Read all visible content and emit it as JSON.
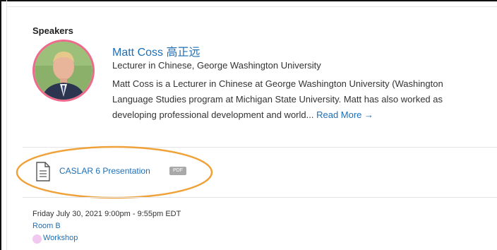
{
  "speakers": {
    "heading": "Speakers",
    "items": [
      {
        "name": "Matt Coss 高正远",
        "title": "Lecturer in Chinese, George Washington University",
        "bio_lines": [
          "Matt Coss is a Lecturer in Chinese at George Washington University (Washington",
          "Language Studies program at Michigan State University. Matt has also worked as",
          "developing professional development and world..."
        ],
        "read_more_label": "Read More →",
        "avatar_icon": "person-photo-icon",
        "avatar_ring_color": "#ee6a8c"
      }
    ]
  },
  "attachment": {
    "label": "CASLAR 6 Presentation",
    "badge": "PDF",
    "icon": "document-icon",
    "highlight_color": "#f0a23a"
  },
  "session": {
    "datetime": "Friday July 30, 2021 9:00pm - 9:55pm EDT",
    "room": "Room B",
    "type_label": "Workshop",
    "type_color": "#f0c8f0"
  },
  "colors": {
    "link": "#1f6fb5",
    "divider": "#e4e4e4"
  }
}
